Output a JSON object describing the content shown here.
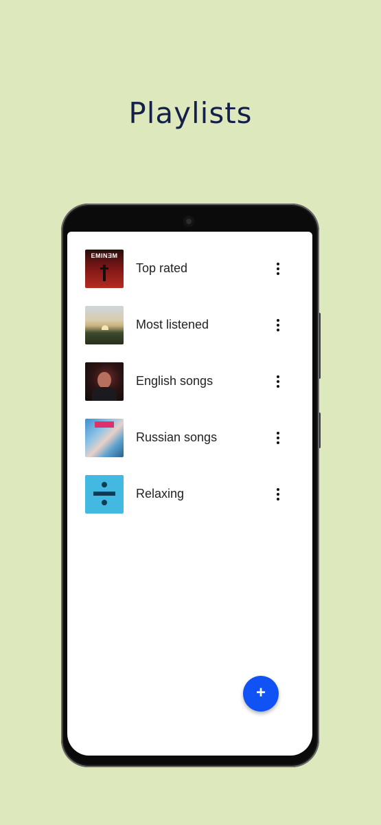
{
  "page": {
    "title": "Playlists"
  },
  "playlists": [
    {
      "label": "Top rated",
      "art": "album-art-eminem",
      "art_text": "EMINƎM"
    },
    {
      "label": "Most listened",
      "art": "album-art-landscape"
    },
    {
      "label": "English songs",
      "art": "album-art-portrait"
    },
    {
      "label": "Russian songs",
      "art": "album-art-collage"
    },
    {
      "label": "Relaxing",
      "art": "album-art-divide"
    }
  ],
  "icons": {
    "more": "more-vert-icon",
    "add": "plus-icon"
  },
  "fab": {
    "label": "+"
  },
  "colors": {
    "background": "#dde8bd",
    "accent": "#1152f5",
    "title": "#14204a"
  }
}
